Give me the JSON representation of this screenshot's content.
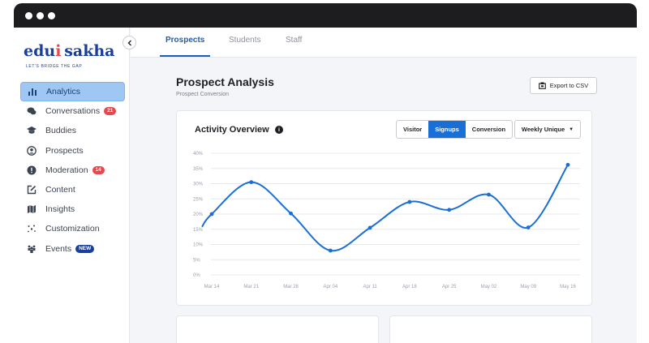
{
  "sidebar": {
    "logo": {
      "name": "edu sakha",
      "tagline": "LET'S BRIDGE THE GAP"
    },
    "items": [
      {
        "label": "Analytics",
        "icon": "bar-chart-icon",
        "active": true
      },
      {
        "label": "Conversations",
        "icon": "chat-bubbles-icon",
        "badge": "21"
      },
      {
        "label": "Buddies",
        "icon": "graduation-cap-icon"
      },
      {
        "label": "Prospects",
        "icon": "user-circle-icon"
      },
      {
        "label": "Moderation",
        "icon": "alert-circle-icon",
        "badge": "14"
      },
      {
        "label": "Content",
        "icon": "edit-square-icon"
      },
      {
        "label": "Insights",
        "icon": "map-icon"
      },
      {
        "label": "Customization",
        "icon": "sparkle-icon"
      },
      {
        "label": "Events",
        "icon": "people-group-icon",
        "badge": "NEW"
      }
    ]
  },
  "tabs": [
    {
      "label": "Prospects",
      "active": true
    },
    {
      "label": "Students"
    },
    {
      "label": "Staff"
    }
  ],
  "page": {
    "title": "Prospect Analysis",
    "subtitle": "Prospect Conversion",
    "export_label": "Export to CSV"
  },
  "activity": {
    "title": "Activity Overview",
    "toggle": [
      "Visitor",
      "Signups",
      "Conversion"
    ],
    "toggle_selected": "Signups",
    "dropdown_label": "Weekly Unique"
  },
  "colors": {
    "accent": "#1a6fd6",
    "badge_red": "#e5484d",
    "brand": "#1a3f9a"
  },
  "chart_data": {
    "type": "line",
    "title": "Activity Overview",
    "y_ticks": [
      "0%",
      "5%",
      "10%",
      "15%",
      "20%",
      "25%",
      "30%",
      "35%",
      "40%"
    ],
    "x_ticks": [
      "Mar 14",
      "Mar 21",
      "Mar 28",
      "Apr 04",
      "Apr 11",
      "Apr 18",
      "Apr 25",
      "May 02",
      "May 09",
      "May 16"
    ],
    "ylim": [
      0,
      40
    ],
    "grid": true,
    "series": [
      {
        "points": [
          {
            "x": "Mar 14",
            "y": 20
          },
          {
            "x": "Mar 21",
            "y": 30.5
          },
          {
            "x": "Mar 28",
            "y": 20.2
          },
          {
            "x": "Apr 04",
            "y": 8
          },
          {
            "x": "Apr 11",
            "y": 15.5
          },
          {
            "x": "Apr 18",
            "y": 24
          },
          {
            "x": "Apr 25",
            "y": 21.4
          },
          {
            "x": "May 02",
            "y": 26.4
          },
          {
            "x": "May 09",
            "y": 15.6
          },
          {
            "x": "May 16",
            "y": 36.2
          }
        ]
      }
    ]
  }
}
